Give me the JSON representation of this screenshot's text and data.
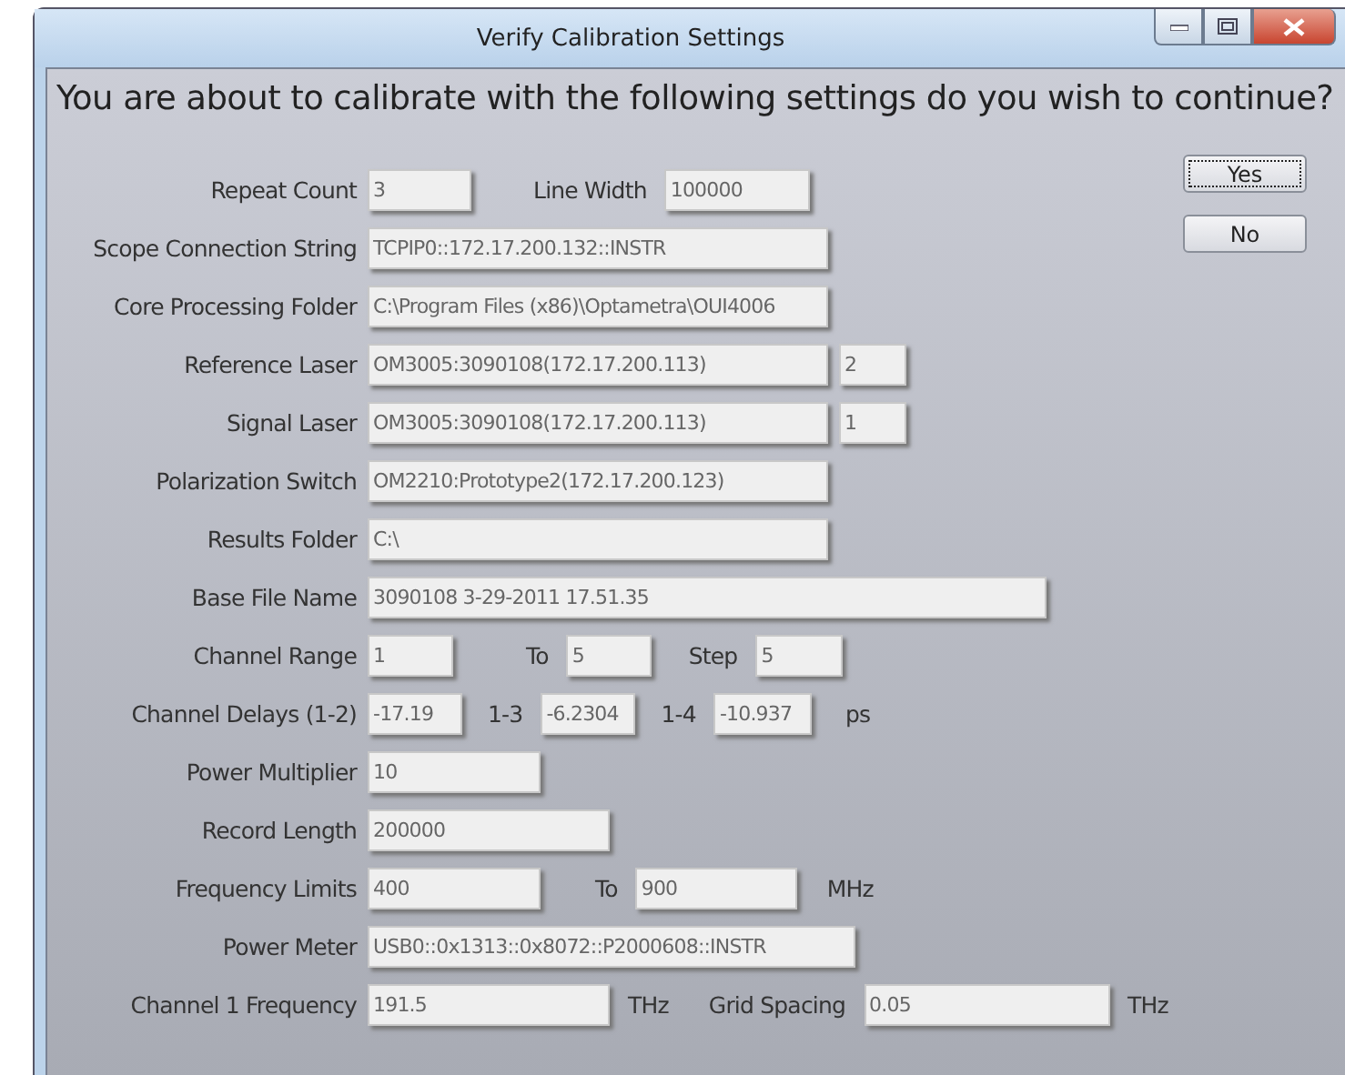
{
  "window": {
    "title": "Verify Calibration Settings"
  },
  "prompt": "You are about to calibrate with the following settings do you wish to continue?",
  "rows": [
    {
      "items": [
        {
          "kind": "label",
          "text": "Repeat Count"
        },
        {
          "kind": "field",
          "value": "3"
        },
        {
          "kind": "label",
          "text": "Line Width"
        },
        {
          "kind": "field",
          "value": "100000"
        }
      ]
    },
    {
      "items": [
        {
          "kind": "label",
          "text": "Scope Connection String"
        },
        {
          "kind": "field",
          "value": "TCPIP0::172.17.200.132::INSTR"
        }
      ]
    },
    {
      "items": [
        {
          "kind": "label",
          "text": "Core Processing Folder"
        },
        {
          "kind": "field",
          "value": "C:\\Program Files (x86)\\Optametra\\OUI4006"
        }
      ]
    },
    {
      "items": [
        {
          "kind": "label",
          "text": "Reference Laser"
        },
        {
          "kind": "field",
          "value": "OM3005:3090108(172.17.200.113)"
        },
        {
          "kind": "field",
          "value": "2"
        }
      ]
    },
    {
      "items": [
        {
          "kind": "label",
          "text": "Signal Laser"
        },
        {
          "kind": "field",
          "value": "OM3005:3090108(172.17.200.113)"
        },
        {
          "kind": "field",
          "value": "1"
        }
      ]
    },
    {
      "items": [
        {
          "kind": "label",
          "text": "Polarization Switch"
        },
        {
          "kind": "field",
          "value": "OM2210:Prototype2(172.17.200.123)"
        }
      ]
    },
    {
      "items": [
        {
          "kind": "label",
          "text": "Results Folder"
        },
        {
          "kind": "field",
          "value": "C:\\"
        }
      ]
    },
    {
      "items": [
        {
          "kind": "label",
          "text": "Base File Name"
        },
        {
          "kind": "field",
          "value": "3090108 3-29-2011 17.51.35"
        }
      ]
    },
    {
      "items": [
        {
          "kind": "label",
          "text": "Channel Range"
        },
        {
          "kind": "field",
          "value": "1"
        },
        {
          "kind": "label",
          "text": "To"
        },
        {
          "kind": "field",
          "value": "5"
        },
        {
          "kind": "label",
          "text": "Step"
        },
        {
          "kind": "field",
          "value": "5"
        }
      ]
    },
    {
      "items": [
        {
          "kind": "label",
          "text": "Channel Delays (1-2)"
        },
        {
          "kind": "field",
          "value": "-17.19"
        },
        {
          "kind": "label",
          "text": "1-3"
        },
        {
          "kind": "field",
          "value": "-6.2304"
        },
        {
          "kind": "label",
          "text": "1-4"
        },
        {
          "kind": "field",
          "value": "-10.937"
        },
        {
          "kind": "label",
          "text": "ps"
        }
      ]
    },
    {
      "items": [
        {
          "kind": "label",
          "text": "Power Multiplier"
        },
        {
          "kind": "field",
          "value": "10"
        }
      ]
    },
    {
      "items": [
        {
          "kind": "label",
          "text": "Record Length"
        },
        {
          "kind": "field",
          "value": "200000"
        }
      ]
    },
    {
      "items": [
        {
          "kind": "label",
          "text": "Frequency Limits"
        },
        {
          "kind": "field",
          "value": "400"
        },
        {
          "kind": "label",
          "text": "To"
        },
        {
          "kind": "field",
          "value": "900"
        },
        {
          "kind": "label",
          "text": "MHz"
        }
      ]
    },
    {
      "items": [
        {
          "kind": "label",
          "text": "Power Meter"
        },
        {
          "kind": "field",
          "value": "USB0::0x1313::0x8072::P2000608::INSTR"
        }
      ]
    },
    {
      "items": [
        {
          "kind": "label",
          "text": "Channel 1 Frequency"
        },
        {
          "kind": "field",
          "value": "191.5"
        },
        {
          "kind": "label",
          "text": "THz"
        },
        {
          "kind": "label",
          "text": "Grid Spacing"
        },
        {
          "kind": "field",
          "value": "0.05"
        },
        {
          "kind": "label",
          "text": "THz"
        }
      ]
    }
  ],
  "buttons": [
    {
      "label": "Yes",
      "focused": true
    },
    {
      "label": "No",
      "focused": false
    }
  ]
}
